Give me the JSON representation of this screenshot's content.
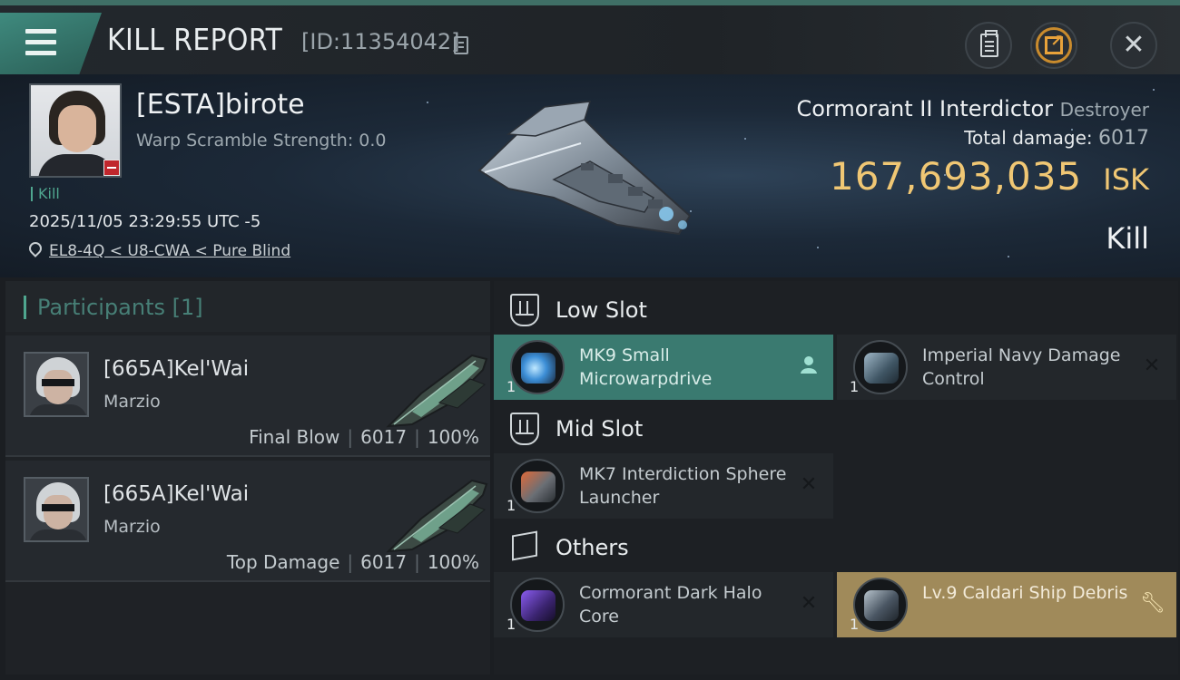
{
  "header": {
    "title": "KILL REPORT",
    "report_id": "[ID:11354042]"
  },
  "victim": {
    "name": "[ESTA]birote",
    "warp_scramble": "Warp Scramble Strength: 0.0",
    "kill_tag": "Kill",
    "datetime": "2025/11/05 23:29:55 UTC -5",
    "location": "EL8-4Q < U8-CWA < Pure Blind"
  },
  "ship": {
    "name": "Cormorant II Interdictor",
    "class": "Destroyer",
    "damage_label": "Total damage:",
    "damage_value": "6017",
    "isk_value": "167,693,035",
    "isk_unit": "ISK",
    "result": "Kill"
  },
  "participants": {
    "title": "Participants [1]",
    "items": [
      {
        "name": "[665A]Kel'Wai",
        "corp": "Marzio",
        "role": "Final Blow",
        "damage": "6017",
        "percent": "100%"
      },
      {
        "name": "[665A]Kel'Wai",
        "corp": "Marzio",
        "role": "Top Damage",
        "damage": "6017",
        "percent": "100%"
      }
    ]
  },
  "slots": {
    "low": {
      "title": "Low Slot",
      "items": [
        {
          "qty": "1",
          "name": "MK9 Small Microwarpdrive",
          "status_icon": "person-icon"
        },
        {
          "qty": "1",
          "name": "Imperial Navy Damage Control",
          "status_icon": "destroyed-x-icon"
        }
      ]
    },
    "mid": {
      "title": "Mid Slot",
      "items": [
        {
          "qty": "1",
          "name": "MK7 Interdiction Sphere Launcher",
          "status_icon": "destroyed-x-icon"
        }
      ]
    },
    "others": {
      "title": "Others",
      "items": [
        {
          "qty": "1",
          "name": "Cormorant Dark Halo Core",
          "status_icon": "destroyed-x-icon"
        },
        {
          "qty": "1",
          "name": "Lv.9 Caldari Ship Debris",
          "status_icon": "wrench-icon"
        }
      ]
    }
  },
  "colors": {
    "accent_teal": "#3a7a70",
    "isk_gold": "#f0c774",
    "dropped_gold": "#a08a5a"
  }
}
